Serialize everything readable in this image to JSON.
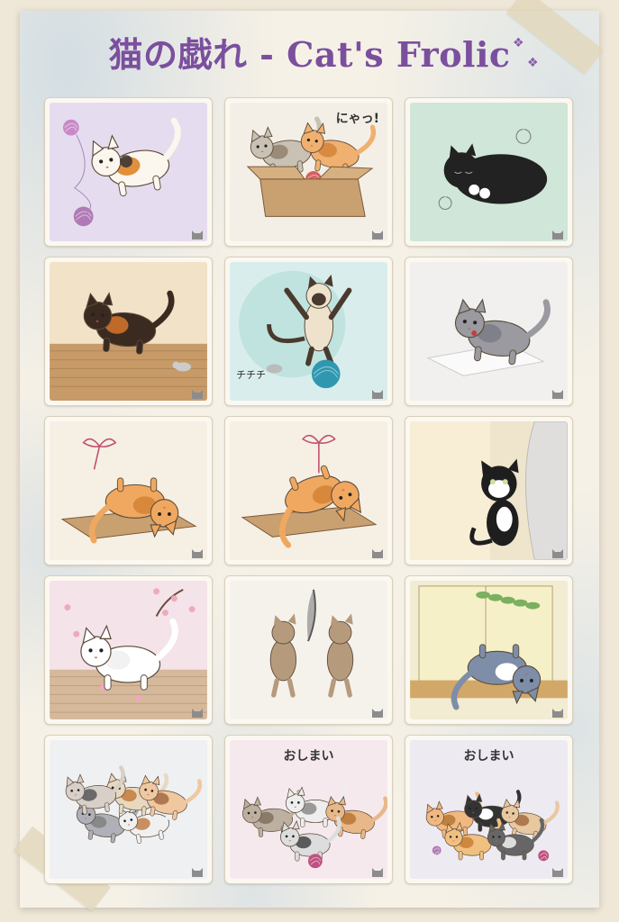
{
  "poster": {
    "title": "猫の戯れ - Cat's Frolic",
    "accent_color": "#7b4f9e"
  },
  "panels": [
    {
      "scene": "calico-chasing-yarn",
      "background": "#e6dcef",
      "caption": ""
    },
    {
      "scene": "two-kittens-in-box",
      "background": "#f4efe6",
      "caption": "にゃっ!"
    },
    {
      "scene": "black-cat-sleeping",
      "background": "#cfe6d8",
      "caption": ""
    },
    {
      "scene": "tortie-stalking-mouse",
      "background": "#f1e2c8",
      "caption": ""
    },
    {
      "scene": "siamese-dancing-on-ball",
      "background": "#d9eeec",
      "caption": "チチチ"
    },
    {
      "scene": "gray-cat-on-pillow",
      "background": "#f1f0ee",
      "caption": ""
    },
    {
      "scene": "orange-cat-rolling-ribbon",
      "background": "#f6efe4",
      "caption": ""
    },
    {
      "scene": "orange-cat-ribbon-play",
      "background": "#f6efe4",
      "caption": ""
    },
    {
      "scene": "tuxedo-peeking-curtain",
      "background": "#e9e2d6",
      "caption": ""
    },
    {
      "scene": "white-cat-cherry-blossoms",
      "background": "#f4e3e8",
      "caption": ""
    },
    {
      "scene": "tabbies-with-feather",
      "background": "#f5f2ec",
      "caption": ""
    },
    {
      "scene": "cat-napping-window",
      "background": "#f1ecd2",
      "caption": ""
    },
    {
      "scene": "kittens-cuddle-pile",
      "background": "#eef0f2",
      "caption": ""
    },
    {
      "scene": "kittens-group-end",
      "background": "#f6e9ee",
      "caption": "おしまい"
    },
    {
      "scene": "kittens-party-end",
      "background": "#eeeaf2",
      "caption": "おしまい"
    }
  ]
}
